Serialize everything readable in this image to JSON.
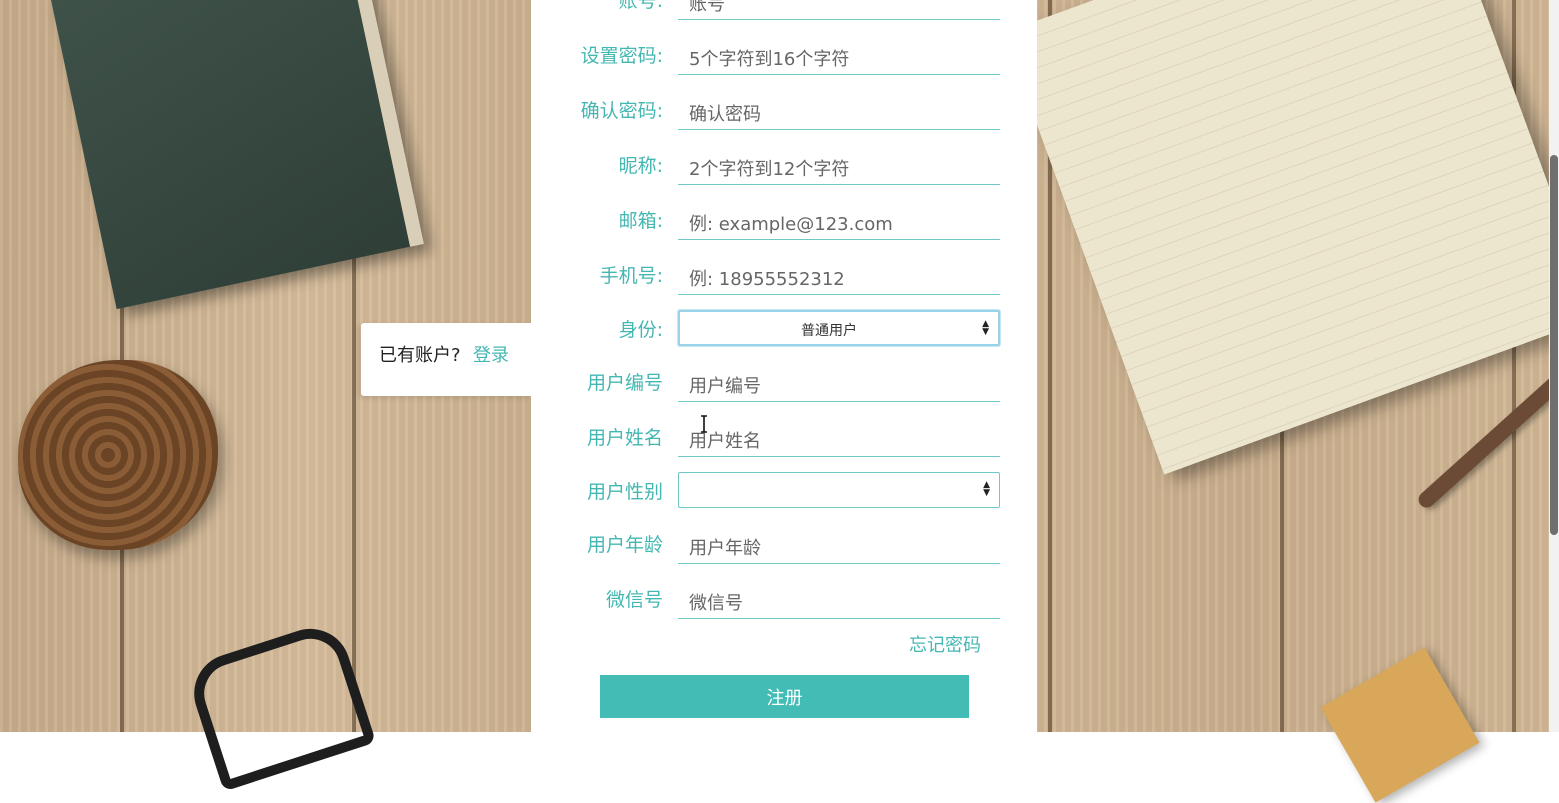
{
  "side_card": {
    "question": "已有账户?",
    "login_link": "登录"
  },
  "form": {
    "fields": {
      "account": {
        "label": "账号:",
        "placeholder": "账号"
      },
      "password": {
        "label": "设置密码:",
        "placeholder": "5个字符到16个字符"
      },
      "confirm_password": {
        "label": "确认密码:",
        "placeholder": "确认密码"
      },
      "nickname": {
        "label": "昵称:",
        "placeholder": "2个字符到12个字符"
      },
      "email": {
        "label": "邮箱:",
        "placeholder": "例: example@123.com"
      },
      "phone": {
        "label": "手机号:",
        "placeholder": "例: 18955552312"
      },
      "identity": {
        "label": "身份:",
        "value": "普通用户"
      },
      "user_no": {
        "label": "用户编号",
        "placeholder": "用户编号"
      },
      "user_name": {
        "label": "用户姓名",
        "placeholder": "用户姓名"
      },
      "user_gender": {
        "label": "用户性别",
        "value": ""
      },
      "user_age": {
        "label": "用户年龄",
        "placeholder": "用户年龄"
      },
      "wechat": {
        "label": "微信号",
        "placeholder": "微信号"
      }
    },
    "forgot_password": "忘记密码",
    "submit_label": "注册"
  },
  "colors": {
    "accent": "#45b7b2",
    "button": "#43bcb5",
    "panel": "#ffffff"
  }
}
